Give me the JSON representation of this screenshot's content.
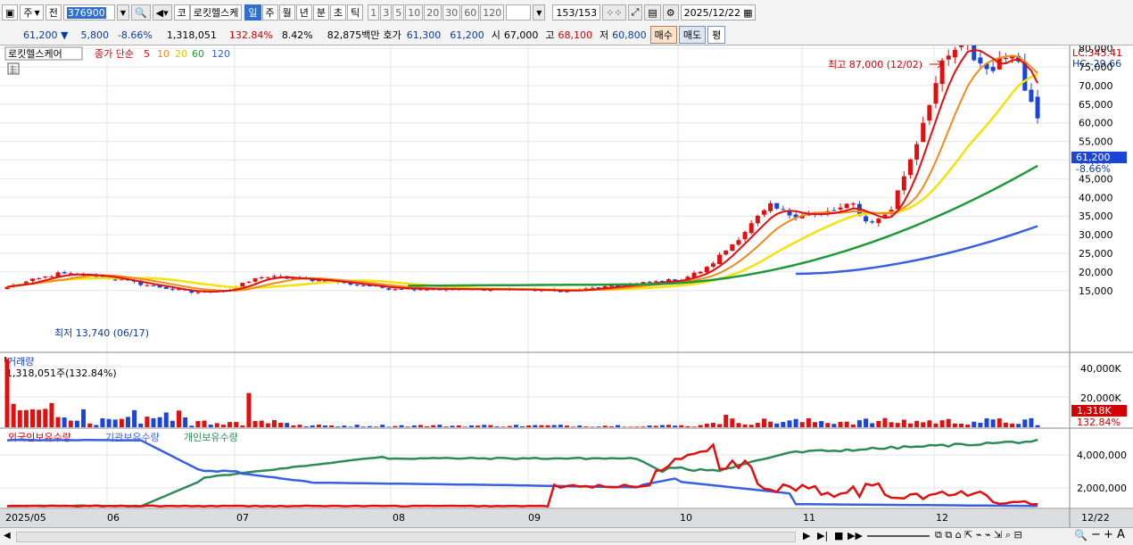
{
  "toolbar": {
    "period_day": "주",
    "prev": "전",
    "code": "376900",
    "market": "코",
    "stock_name": "로킷헬스케",
    "periods": [
      "일",
      "주",
      "월",
      "년",
      "분",
      "초",
      "틱"
    ],
    "selected_period": "일",
    "minute_buttons": [
      "1",
      "3",
      "5",
      "10",
      "20",
      "30",
      "60",
      "120"
    ],
    "count": "153",
    "count_total": "/153",
    "date": "2025/12/22"
  },
  "infobar": {
    "price": "61,200 ▼",
    "change": "5,800",
    "change_pct": "-8.66%",
    "volume": "1,318,051",
    "volume_ratio": "132.84%",
    "turnover": "8.42%",
    "amount": "82,875백만",
    "ask_label": "호가",
    "ask1": "61,300",
    "ask2": "61,200",
    "open_label": "시",
    "open": "67,000",
    "high_label": "고",
    "high": "68,100",
    "low_label": "저",
    "low": "60,800",
    "sell_btn": "매수",
    "buy_btn": "매도",
    "eval_btn": "평"
  },
  "legend": {
    "stock_box": "로킷헬스케어",
    "ma_title": "종가 단순",
    "ma": [
      "5",
      "10",
      "20",
      "60",
      "120"
    ]
  },
  "price_panel": {
    "lc_label": "LC:345.41",
    "hc_label": "HC:-29.66",
    "max_label": "최고 87,000 (12/02)",
    "min_label": "최저 13,740 (06/17)",
    "last_price_box": "61,200",
    "last_pct_box": "-8.66%"
  },
  "volume_panel": {
    "title": "거래량",
    "subtitle": "1,318,051주(132.84%)",
    "last_box": "1,318K",
    "last_pct": "132.84%",
    "ticks": [
      "40,000K",
      "20,000K"
    ]
  },
  "holding_panel": {
    "titles": [
      "외국인보유수량",
      "기관보유수량",
      "개인보유수량"
    ],
    "ticks": [
      "4,000,000",
      "2,000,000"
    ]
  },
  "x_labels": [
    "2025/05",
    "06",
    "07",
    "08",
    "09",
    "10",
    "11",
    "12",
    "12/22"
  ],
  "colors": {
    "up": "#e01010",
    "down": "#1a45d8",
    "ma5": "#e01010",
    "ma10": "#f08a1a",
    "ma20": "#f5e20a",
    "ma60": "#1f9a3a",
    "ma120": "#3860e0",
    "foreign": "#e01010",
    "inst": "#3860e0",
    "indiv": "#2e8b57"
  },
  "chart_data": {
    "type": "candlestick",
    "ylim": [
      10000,
      90000
    ],
    "y_ticks": [
      15000,
      20000,
      25000,
      30000,
      35000,
      40000,
      45000,
      50000,
      55000,
      60000,
      65000,
      70000,
      75000,
      80000
    ],
    "anchors": {
      "close": [
        [
          0,
          16000
        ],
        [
          8,
          19500
        ],
        [
          14,
          19000
        ],
        [
          22,
          16500
        ],
        [
          29,
          14500
        ],
        [
          35,
          15300
        ],
        [
          40,
          18800
        ],
        [
          49,
          17800
        ],
        [
          60,
          15600
        ],
        [
          70,
          15400
        ],
        [
          80,
          15300
        ],
        [
          88,
          14900
        ],
        [
          92,
          15600
        ],
        [
          100,
          17000
        ],
        [
          106,
          18000
        ],
        [
          110,
          21000
        ],
        [
          114,
          27500
        ],
        [
          118,
          34500
        ],
        [
          120,
          37500
        ],
        [
          123,
          35500
        ],
        [
          128,
          35500
        ],
        [
          131,
          37000
        ],
        [
          133,
          38000
        ],
        [
          135,
          33500
        ],
        [
          137,
          34000
        ],
        [
          139,
          37000
        ],
        [
          141,
          46000
        ],
        [
          143,
          55000
        ],
        [
          145,
          66000
        ],
        [
          147,
          75000
        ],
        [
          149,
          79500
        ],
        [
          150,
          80500
        ],
        [
          151,
          83000
        ],
        [
          152,
          77500
        ],
        [
          154,
          74500
        ],
        [
          156,
          76000
        ],
        [
          158,
          80000
        ],
        [
          159,
          76000
        ],
        [
          160,
          69000
        ],
        [
          161,
          67000
        ],
        [
          162,
          61200
        ]
      ]
    },
    "ma_start": {
      "ma60": 124,
      "ma120": 124
    },
    "ma_range": {
      "ma60": [
        19500,
        48500
      ],
      "ma120": [
        19500,
        32300
      ]
    },
    "volume": {
      "ylim": [
        0,
        47000000
      ],
      "last": 1318051
    },
    "holdings": {
      "ylim": [
        0,
        5300000
      ]
    }
  }
}
